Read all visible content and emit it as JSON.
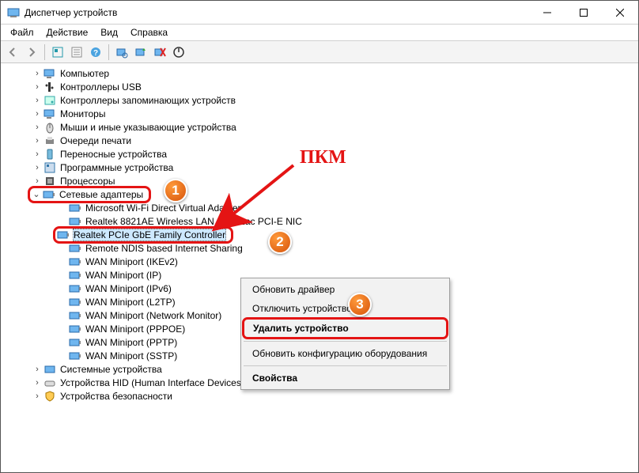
{
  "window": {
    "title": "Диспетчер устройств"
  },
  "menubar": [
    "Файл",
    "Действие",
    "Вид",
    "Справка"
  ],
  "tree": {
    "top": [
      {
        "label": "Компьютер",
        "icon": "monitor"
      },
      {
        "label": "Контроллеры USB",
        "icon": "usb"
      },
      {
        "label": "Контроллеры запоминающих устройств",
        "icon": "storage"
      },
      {
        "label": "Мониторы",
        "icon": "monitor"
      },
      {
        "label": "Мыши и иные указывающие устройства",
        "icon": "mouse"
      },
      {
        "label": "Очереди печати",
        "icon": "printer"
      },
      {
        "label": "Переносные устройства",
        "icon": "portable"
      },
      {
        "label": "Программные устройства",
        "icon": "software"
      },
      {
        "label": "Процессоры",
        "icon": "cpu"
      }
    ],
    "network_category": "Сетевые адаптеры",
    "adapters": [
      "Microsoft Wi-Fi Direct Virtual Adapter",
      "Realtek 8821AE Wireless LAN 802.11ac PCI-E NIC",
      "Realtek PCIe GbE Family Controller",
      "Remote NDIS based Internet Sharing",
      "WAN Miniport (IKEv2)",
      "WAN Miniport (IP)",
      "WAN Miniport (IPv6)",
      "WAN Miniport (L2TP)",
      "WAN Miniport (Network Monitor)",
      "WAN Miniport (PPPOE)",
      "WAN Miniport (PPTP)",
      "WAN Miniport (SSTP)"
    ],
    "bottom": [
      {
        "label": "Системные устройства",
        "icon": "system"
      },
      {
        "label": "Устройства HID (Human Interface Devices)",
        "icon": "hid"
      },
      {
        "label": "Устройства безопасности",
        "icon": "security"
      }
    ]
  },
  "context_menu": {
    "items": [
      "Обновить драйвер",
      "Отключить устройство",
      "Удалить устройство",
      "Обновить конфигурацию оборудования",
      "Свойства"
    ]
  },
  "annotations": {
    "pkm": "ПКМ",
    "badge1": "1",
    "badge2": "2",
    "badge3": "3"
  }
}
